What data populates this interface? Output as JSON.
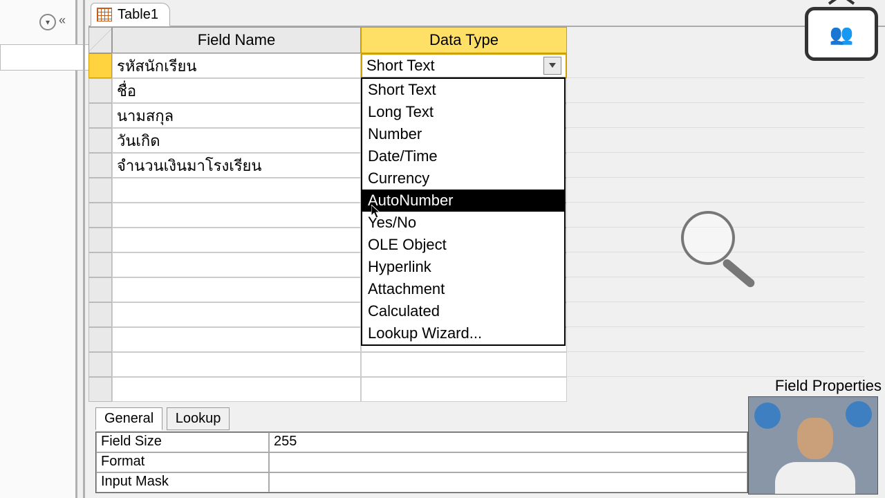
{
  "tab": {
    "label": "Table1"
  },
  "columns": {
    "field_name": "Field Name",
    "data_type": "Data Type"
  },
  "rows": [
    {
      "name": "รหัสนักเรียน",
      "type": "Short Text"
    },
    {
      "name": "ชื่อ",
      "type": ""
    },
    {
      "name": "นามสกุล",
      "type": ""
    },
    {
      "name": "วันเกิด",
      "type": ""
    },
    {
      "name": "จำนวนเงินมาโรงเรียน",
      "type": ""
    }
  ],
  "datatype_options": [
    "Short Text",
    "Long Text",
    "Number",
    "Date/Time",
    "Currency",
    "AutoNumber",
    "Yes/No",
    "OLE Object",
    "Hyperlink",
    "Attachment",
    "Calculated",
    "Lookup Wizard..."
  ],
  "highlighted_option": "AutoNumber",
  "field_properties_label": "Field Properties",
  "prop_tabs": {
    "general": "General",
    "lookup": "Lookup"
  },
  "properties": [
    {
      "label": "Field Size",
      "value": "255"
    },
    {
      "label": "Format",
      "value": ""
    },
    {
      "label": "Input Mask",
      "value": ""
    }
  ]
}
